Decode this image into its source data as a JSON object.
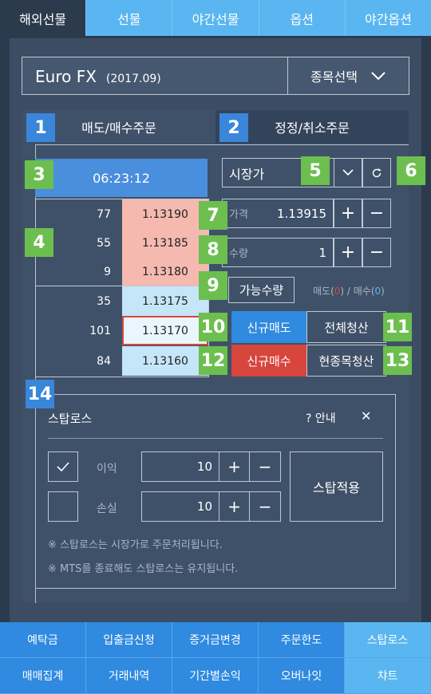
{
  "top_tabs": [
    "해외선물",
    "선물",
    "야간선물",
    "옵션",
    "야간옵션"
  ],
  "symbol": {
    "name": "Euro FX",
    "month": "(2017.09)",
    "select_label": "종목선택"
  },
  "sub_tabs": {
    "left": "매도/매수주문",
    "right": "정정/취소주문"
  },
  "time": "06:23:12",
  "order_type": "시장가",
  "orderbook": [
    {
      "qty": "77",
      "price": "1.13190",
      "side": "ask"
    },
    {
      "qty": "55",
      "price": "1.13185",
      "side": "ask"
    },
    {
      "qty": "9",
      "price": "1.13180",
      "side": "ask"
    },
    {
      "qty": "35",
      "price": "1.13175",
      "side": "bid"
    },
    {
      "qty": "101",
      "price": "1.13170",
      "side": "current"
    },
    {
      "qty": "84",
      "price": "1.13160",
      "side": "bid"
    }
  ],
  "price": {
    "label": "가격",
    "value": "1.13915"
  },
  "quantity": {
    "label": "수량",
    "value": "1"
  },
  "available_qty_label": "가능수량",
  "available_info": {
    "sell_prefix": "매도(",
    "sell_value": "0",
    "sell_suffix": ") / 매수(",
    "buy_value": "0",
    "buy_suffix": ")"
  },
  "actions": {
    "new_sell": "신규매도",
    "liquidate_all": "전체청산",
    "new_buy": "신규매수",
    "liquidate_current": "현종목청산"
  },
  "badges": [
    "1",
    "2",
    "3",
    "4",
    "5",
    "6",
    "7",
    "8",
    "9",
    "10",
    "11",
    "12",
    "13",
    "14"
  ],
  "stoploss": {
    "title": "스탑로스",
    "guide": "? 안내",
    "close": "✕",
    "profit_label": "이익",
    "profit_value": "10",
    "loss_label": "손실",
    "loss_value": "10",
    "plus": "+",
    "minus": "−",
    "apply": "스탑적용",
    "notes": [
      "※ 스탑로스는 시장가로 주문처리됩니다.",
      "※ MTS를 종료해도 스탑로스는 유지됩니다."
    ]
  },
  "bottom_menu": [
    [
      "예탁금",
      "입출금신청",
      "증거금변경",
      "주문한도",
      "스탑로스"
    ],
    [
      "매매집계",
      "거래내역",
      "기간별손익",
      "오버나잇",
      "챠트"
    ]
  ],
  "colors": {
    "ask": "#f5b9b0",
    "bid": "#c5e6f8",
    "sell": "#2f8ae0",
    "buy": "#d8453d",
    "accent": "#5ab6f0"
  }
}
